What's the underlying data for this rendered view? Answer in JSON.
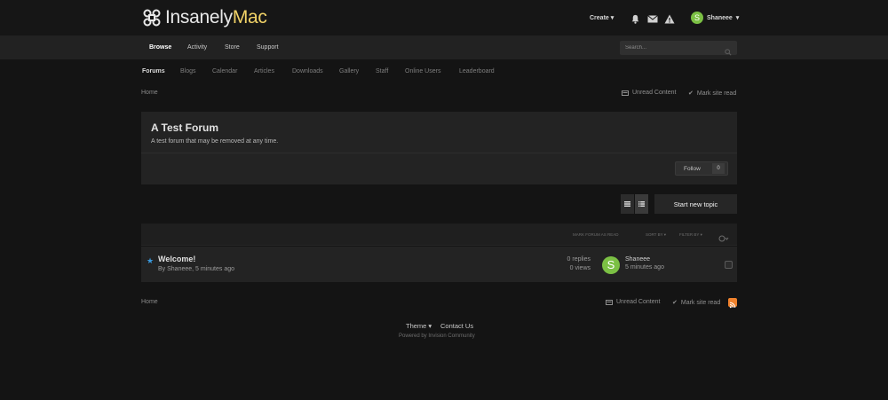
{
  "header": {
    "logo": {
      "brand_main": "Insanely",
      "brand_accent": "Mac"
    },
    "create_label": "Create",
    "user": {
      "avatar_letter": "S",
      "name": "Shaneee"
    },
    "icons": [
      "bell-icon",
      "envelope-icon",
      "warning-icon"
    ]
  },
  "nav": {
    "items": [
      {
        "label": "Browse"
      },
      {
        "label": "Activity"
      },
      {
        "label": "Store"
      },
      {
        "label": "Support"
      }
    ],
    "search_placeholder": "Search..."
  },
  "subnav": {
    "items": [
      {
        "label": "Forums"
      },
      {
        "label": "Blogs"
      },
      {
        "label": "Calendar"
      },
      {
        "label": "Articles"
      },
      {
        "label": "Downloads"
      },
      {
        "label": "Gallery"
      },
      {
        "label": "Staff"
      },
      {
        "label": "Online Users"
      },
      {
        "label": "Leaderboard"
      }
    ]
  },
  "breadcrumb": {
    "home": "Home"
  },
  "utilities": {
    "unread": "Unread Content",
    "mark_read": "Mark site read"
  },
  "forum": {
    "title": "A Test Forum",
    "description": "A test forum that may be removed at any time.",
    "follow_label": "Follow",
    "follow_count": "0"
  },
  "actions": {
    "start_topic": "Start new topic"
  },
  "filters": {
    "mark_read": "Mark forum as read",
    "sort_by": "Sort By",
    "filter_by": "Filter By"
  },
  "topics": [
    {
      "title": "Welcome!",
      "meta": "By Shaneee, 5 minutes ago",
      "replies": "0 replies",
      "views": "0 views",
      "last_poster": {
        "avatar_letter": "S",
        "name": "Shaneee",
        "time": "5 minutes ago"
      }
    }
  ],
  "footer": {
    "theme": "Theme",
    "contact": "Contact Us",
    "powered": "Powered by Invision Community"
  },
  "colors": {
    "accent": "#f1d267",
    "avatar": "#7bc044",
    "star": "#3a9be0",
    "rss": "#f0822d"
  }
}
